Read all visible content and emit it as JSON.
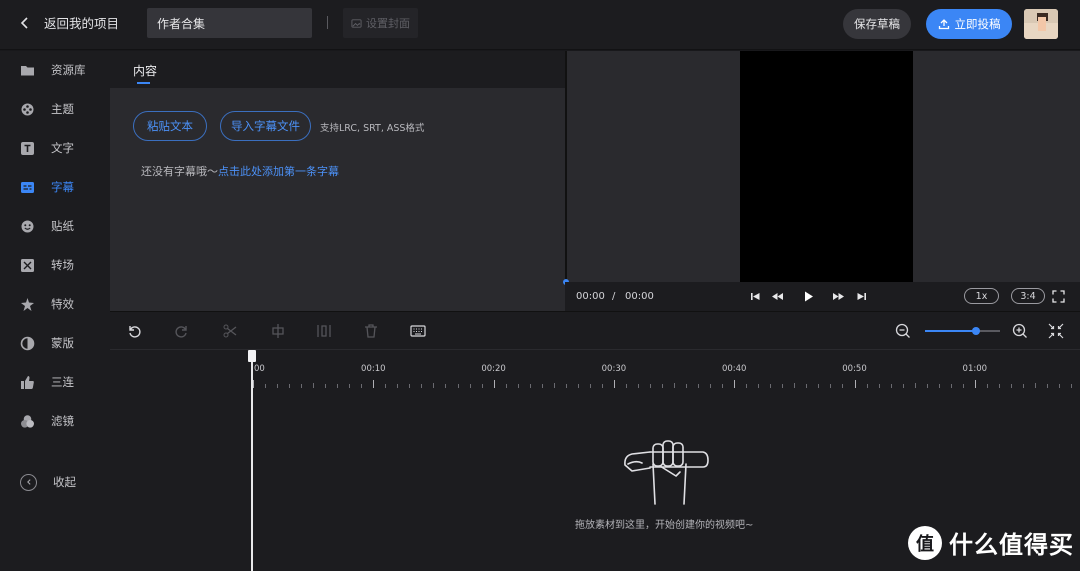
{
  "topbar": {
    "back_label": "返回我的项目",
    "project_title": "作者合集",
    "set_cover_label": "设置封面",
    "save_draft_label": "保存草稿",
    "publish_label": "立即投稿"
  },
  "sidebar": {
    "items": [
      {
        "label": "资源库",
        "icon": "folder-icon"
      },
      {
        "label": "主题",
        "icon": "theme-icon"
      },
      {
        "label": "文字",
        "icon": "text-icon"
      },
      {
        "label": "字幕",
        "icon": "subtitle-icon",
        "active": true
      },
      {
        "label": "贴纸",
        "icon": "sticker-icon"
      },
      {
        "label": "转场",
        "icon": "transition-icon"
      },
      {
        "label": "特效",
        "icon": "effects-icon"
      },
      {
        "label": "蒙版",
        "icon": "mask-icon"
      },
      {
        "label": "三连",
        "icon": "thumbs-up-icon"
      },
      {
        "label": "滤镜",
        "icon": "filter-icon"
      }
    ],
    "collapse_label": "收起"
  },
  "panel": {
    "tab_label": "内容",
    "paste_text_label": "粘贴文本",
    "import_subtitle_label": "导入字幕文件",
    "supported_formats": "支持LRC, SRT, ASS格式",
    "empty_hint_prefix": "还没有字幕哦～",
    "empty_hint_link": "点击此处添加第一条字幕"
  },
  "player": {
    "current_time": "00:00",
    "separator": "/",
    "total_time": "00:00",
    "speed_label": "1x",
    "aspect_label": "3:4"
  },
  "timeline": {
    "zoom_level": 0.68,
    "labels": [
      "00",
      "00:10",
      "00:20",
      "00:30",
      "00:40",
      "00:50",
      "01:00"
    ],
    "empty_text": "拖放素材到这里，开始创建你的视频吧~"
  },
  "watermark": {
    "logo_text": "值",
    "text": "什么值得买"
  },
  "colors": {
    "accent": "#3b86f5",
    "background": "#18181b",
    "panel": "#2a2a2e"
  }
}
